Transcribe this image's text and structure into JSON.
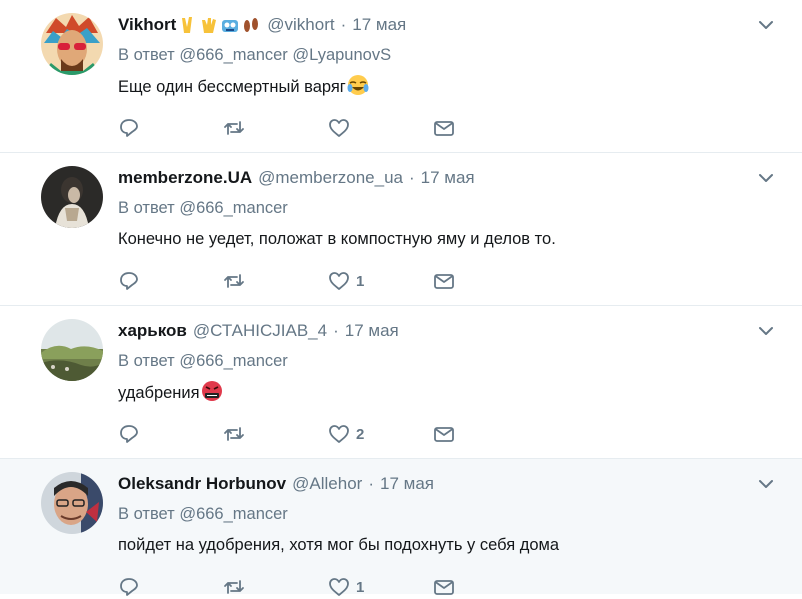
{
  "tweets": [
    {
      "name": "Vikhort",
      "handle": "@vikhort",
      "dot": "·",
      "time": "17 мая",
      "reply_prefix": "В ответ",
      "mentions": "@666_mancer @LyapunovS",
      "text": "Еще один бессмертный варяг",
      "likes": "",
      "emojis": [
        "v-sign-emoji",
        "vulcan-salute-emoji",
        "robot-emoji",
        "footprints-emoji"
      ],
      "text_emoji": "tears-of-joy-emoji"
    },
    {
      "name": "memberzone.UA",
      "handle": "@memberzone_ua",
      "dot": "·",
      "time": "17 мая",
      "reply_prefix": "В ответ",
      "mentions": "@666_mancer",
      "text": "Конечно не уедет, положат в компостную яму и делов то.",
      "likes": "1"
    },
    {
      "name": "харьков",
      "handle": "@СТАНІСJIAB_4",
      "dot": "·",
      "time": "17 мая",
      "reply_prefix": "В ответ",
      "mentions": "@666_mancer",
      "text": "удабрения",
      "likes": "2",
      "text_emoji": "cursing-face-emoji"
    },
    {
      "name": "Oleksandr Horbunov",
      "handle": "@Allehor",
      "dot": "·",
      "time": "17 мая",
      "reply_prefix": "В ответ",
      "mentions": "@666_mancer",
      "text": "пойдет на удобрения, хотя мог бы подохнуть у себя дома",
      "likes": "1"
    }
  ],
  "icons": [
    "reply-icon",
    "retweet-icon",
    "like-icon",
    "direct-message-icon",
    "chevron-down-icon"
  ],
  "colors": {
    "secondary_text": "#657786",
    "divider": "#e6ecf0",
    "highlight_bg": "#f5f8fa"
  }
}
